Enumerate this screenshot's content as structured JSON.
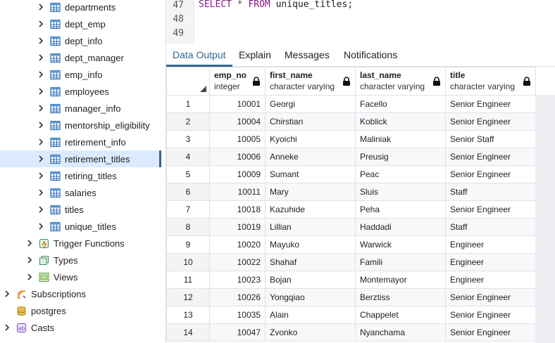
{
  "sidebar": {
    "items": [
      {
        "label": "departments",
        "icon": "table-icon",
        "indent": 2,
        "selected": false
      },
      {
        "label": "dept_emp",
        "icon": "table-icon",
        "indent": 2,
        "selected": false
      },
      {
        "label": "dept_info",
        "icon": "table-icon",
        "indent": 2,
        "selected": false
      },
      {
        "label": "dept_manager",
        "icon": "table-icon",
        "indent": 2,
        "selected": false
      },
      {
        "label": "emp_info",
        "icon": "table-icon",
        "indent": 2,
        "selected": false
      },
      {
        "label": "employees",
        "icon": "table-icon",
        "indent": 2,
        "selected": false
      },
      {
        "label": "manager_info",
        "icon": "table-icon",
        "indent": 2,
        "selected": false
      },
      {
        "label": "mentorship_eligibility",
        "icon": "table-icon",
        "indent": 2,
        "selected": false
      },
      {
        "label": "retirement_info",
        "icon": "table-icon",
        "indent": 2,
        "selected": false
      },
      {
        "label": "retirement_titles",
        "icon": "table-icon",
        "indent": 2,
        "selected": true
      },
      {
        "label": "retiring_titles",
        "icon": "table-icon",
        "indent": 2,
        "selected": false
      },
      {
        "label": "salaries",
        "icon": "table-icon",
        "indent": 2,
        "selected": false
      },
      {
        "label": "titles",
        "icon": "table-icon",
        "indent": 2,
        "selected": false
      },
      {
        "label": "unique_titles",
        "icon": "table-icon",
        "indent": 2,
        "selected": false
      },
      {
        "label": "Trigger Functions",
        "icon": "trigger-functions-icon",
        "indent": 1,
        "selected": false
      },
      {
        "label": "Types",
        "icon": "types-icon",
        "indent": 1,
        "selected": false
      },
      {
        "label": "Views",
        "icon": "views-icon",
        "indent": 1,
        "selected": false
      },
      {
        "label": "Subscriptions",
        "icon": "subscriptions-icon",
        "indent": 0,
        "selected": false
      },
      {
        "label": "postgres",
        "icon": "database-icon",
        "indent": 0,
        "selected": false,
        "nochevron": true
      },
      {
        "label": "Casts",
        "icon": "casts-icon",
        "indent": 0,
        "selected": false
      }
    ]
  },
  "editor": {
    "line_numbers": [
      "47",
      "48",
      "49"
    ],
    "code": {
      "kw1": "SELECT",
      "op": "*",
      "kw2": "FROM",
      "ident": "unique_titles;"
    }
  },
  "tabs": [
    "Data Output",
    "Explain",
    "Messages",
    "Notifications"
  ],
  "active_tab": "Data Output",
  "grid": {
    "columns": [
      {
        "name": "emp_no",
        "type": "integer"
      },
      {
        "name": "first_name",
        "type": "character varying"
      },
      {
        "name": "last_name",
        "type": "character varying"
      },
      {
        "name": "title",
        "type": "character varying"
      }
    ],
    "rows": [
      [
        "1",
        "10001",
        "Georgi",
        "Facello",
        "Senior Engineer"
      ],
      [
        "2",
        "10004",
        "Chirstian",
        "Koblick",
        "Senior Engineer"
      ],
      [
        "3",
        "10005",
        "Kyoichi",
        "Maliniak",
        "Senior Staff"
      ],
      [
        "4",
        "10006",
        "Anneke",
        "Preusig",
        "Senior Engineer"
      ],
      [
        "5",
        "10009",
        "Sumant",
        "Peac",
        "Senior Engineer"
      ],
      [
        "6",
        "10011",
        "Mary",
        "Sluis",
        "Staff"
      ],
      [
        "7",
        "10018",
        "Kazuhide",
        "Peha",
        "Senior Engineer"
      ],
      [
        "8",
        "10019",
        "Lillian",
        "Haddadi",
        "Staff"
      ],
      [
        "9",
        "10020",
        "Mayuko",
        "Warwick",
        "Engineer"
      ],
      [
        "10",
        "10022",
        "Shahaf",
        "Famili",
        "Engineer"
      ],
      [
        "11",
        "10023",
        "Bojan",
        "Montemayor",
        "Engineer"
      ],
      [
        "12",
        "10026",
        "Yongqiao",
        "Berztiss",
        "Senior Engineer"
      ],
      [
        "13",
        "10035",
        "Alain",
        "Chappelet",
        "Senior Engineer"
      ],
      [
        "14",
        "10047",
        "Zvonko",
        "Nyanchama",
        "Senior Engineer"
      ]
    ]
  },
  "colors": {
    "accent": "#326690",
    "selected_bg": "#dbeafe",
    "keyword": "#8a1a8a"
  }
}
